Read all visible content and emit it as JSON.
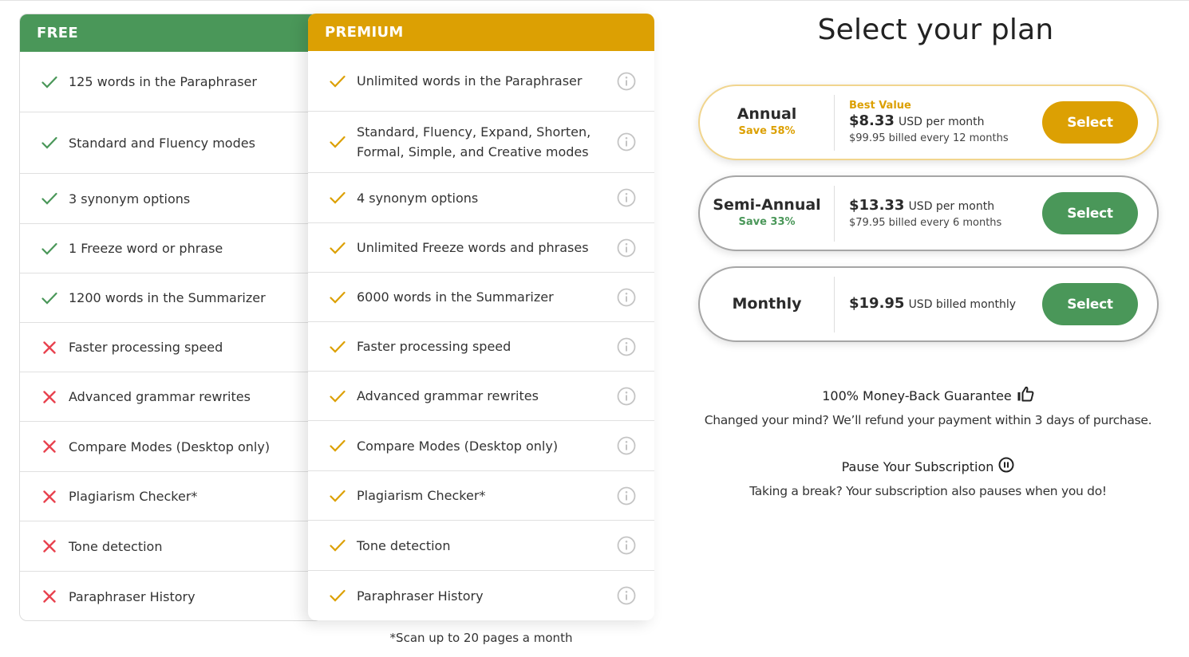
{
  "colors": {
    "free": "#4a9759",
    "premium": "#dca003",
    "cross": "#e8424f",
    "info": "#c4c4c4"
  },
  "comparison": {
    "free": {
      "header": "FREE",
      "rows": [
        {
          "status": "check",
          "label": "125 words in the Paraphraser"
        },
        {
          "status": "check",
          "label": "Standard and Fluency modes"
        },
        {
          "status": "check",
          "label": "3 synonym options"
        },
        {
          "status": "check",
          "label": "1 Freeze word or phrase"
        },
        {
          "status": "check",
          "label": "1200 words in the Summarizer"
        },
        {
          "status": "cross",
          "label": "Faster processing speed"
        },
        {
          "status": "cross",
          "label": "Advanced grammar rewrites"
        },
        {
          "status": "cross",
          "label": "Compare Modes (Desktop only)"
        },
        {
          "status": "cross",
          "label": "Plagiarism Checker*"
        },
        {
          "status": "cross",
          "label": "Tone detection"
        },
        {
          "status": "cross",
          "label": "Paraphraser History"
        }
      ]
    },
    "premium": {
      "header": "PREMIUM",
      "rows": [
        {
          "status": "check",
          "label": "Unlimited words in the Paraphraser",
          "icon": "info-icon"
        },
        {
          "status": "check",
          "label": "Standard, Fluency, Expand, Shorten, Formal, Simple, and Creative modes",
          "icon": "info-icon"
        },
        {
          "status": "check",
          "label": "4 synonym options",
          "icon": "info-icon"
        },
        {
          "status": "check",
          "label": "Unlimited Freeze words and phrases",
          "icon": "info-icon"
        },
        {
          "status": "check",
          "label": "6000 words in the Summarizer",
          "icon": "info-icon"
        },
        {
          "status": "check",
          "label": "Faster processing speed",
          "icon": "info-icon"
        },
        {
          "status": "check",
          "label": "Advanced grammar rewrites",
          "icon": "info-icon"
        },
        {
          "status": "check",
          "label": "Compare Modes (Desktop only)",
          "icon": "info-icon"
        },
        {
          "status": "check",
          "label": "Plagiarism Checker*",
          "icon": "info-icon"
        },
        {
          "status": "check",
          "label": "Tone detection",
          "icon": "info-icon"
        },
        {
          "status": "check",
          "label": "Paraphraser History",
          "icon": "info-icon"
        }
      ]
    },
    "footnote": "*Scan up to 20 pages a month"
  },
  "plans": {
    "title": "Select your plan",
    "items": [
      {
        "name": "Annual",
        "save": "Save 58%",
        "badge": "Best Value",
        "price": "$8.33",
        "unit": "USD per month",
        "billing": "$99.95 billed every 12 months",
        "button": "Select"
      },
      {
        "name": "Semi-Annual",
        "save": "Save 33%",
        "price": "$13.33",
        "unit": "USD per month",
        "billing": "$79.95 billed every 6 months",
        "button": "Select"
      },
      {
        "name": "Monthly",
        "price": "$19.95",
        "unit": "USD billed monthly",
        "button": "Select"
      }
    ]
  },
  "guarantee": {
    "title": "100% Money-Back Guarantee",
    "icon": "thumbs-up-icon",
    "text": "Changed your mind? We’ll refund your payment within 3 days of purchase."
  },
  "pause": {
    "title": "Pause Your Subscription",
    "icon": "pause-circle-icon",
    "text": "Taking a break? Your subscription also pauses when you do!"
  }
}
